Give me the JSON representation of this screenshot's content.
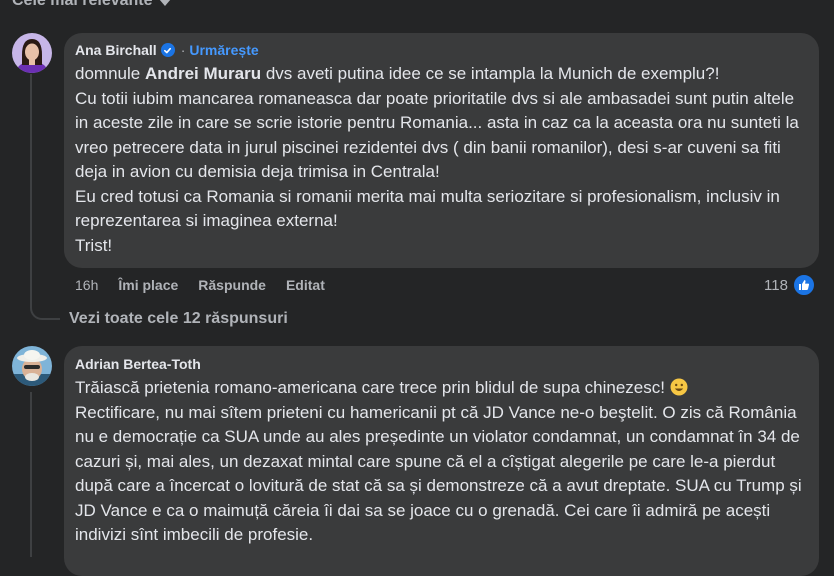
{
  "sort": {
    "label": "Cele mai relevante"
  },
  "comment1": {
    "author": "Ana Birchall",
    "separator": "·",
    "follow": "Urmărește",
    "mention": "Andrei Muraru",
    "line1_before": "domnule ",
    "line1_after": " dvs aveti putina idee ce se intampla la Munich de exemplu?!",
    "paragraphs": [
      "Cu totii iubim mancarea romaneasca dar poate prioritatile dvs si ale ambasadei sunt putin altele in aceste zile in care se scrie istorie pentru Romania... asta in caz ca la aceasta ora nu sunteti la vreo petrecere data in jurul piscinei rezidentei dvs ( din banii romanilor), desi s-ar cuveni sa fiti deja in avion cu demisia deja trimisa in Centrala!",
      "Eu cred totusi ca Romania si romanii merita mai multa seriozitare si profesionalism, inclusiv in reprezentarea si imaginea externa!",
      "Trist!"
    ],
    "time": "16h",
    "like": "Îmi place",
    "reply": "Răspunde",
    "edited": "Editat",
    "reaction_count": "118",
    "replies_link": "Vezi toate cele 12 răspunsuri"
  },
  "comment2": {
    "author": "Adrian Bertea-Toth",
    "line1": "Trăiască prietenia romano-americana care trece prin blidul de supa chinezesc!",
    "rest": "Rectificare, nu mai sîtem prieteni cu hamericanii pt că JD Vance ne-o beştelit. O zis că România nu e democrație ca SUA unde au ales președinte un violator condamnat, un condamnat în 34 de cazuri și, mai ales, un dezaxat mintal care spune că el a cîștigat alegerile pe care le-a pierdut după care a încercat o lovitură de stat că sa și demonstreze că a avut dreptate. SUA cu Trump și JD Vance e ca o maimuță căreia îi dai sa se joace cu o grenadă. Cei care îi admiră pe acești indivizi sînt imbecili de profesie."
  },
  "colors": {
    "background": "#242526",
    "bubble": "#3a3b3c",
    "link": "#4599ff",
    "verified": "#1b74e4",
    "secondary_text": "#b0b3b8"
  }
}
